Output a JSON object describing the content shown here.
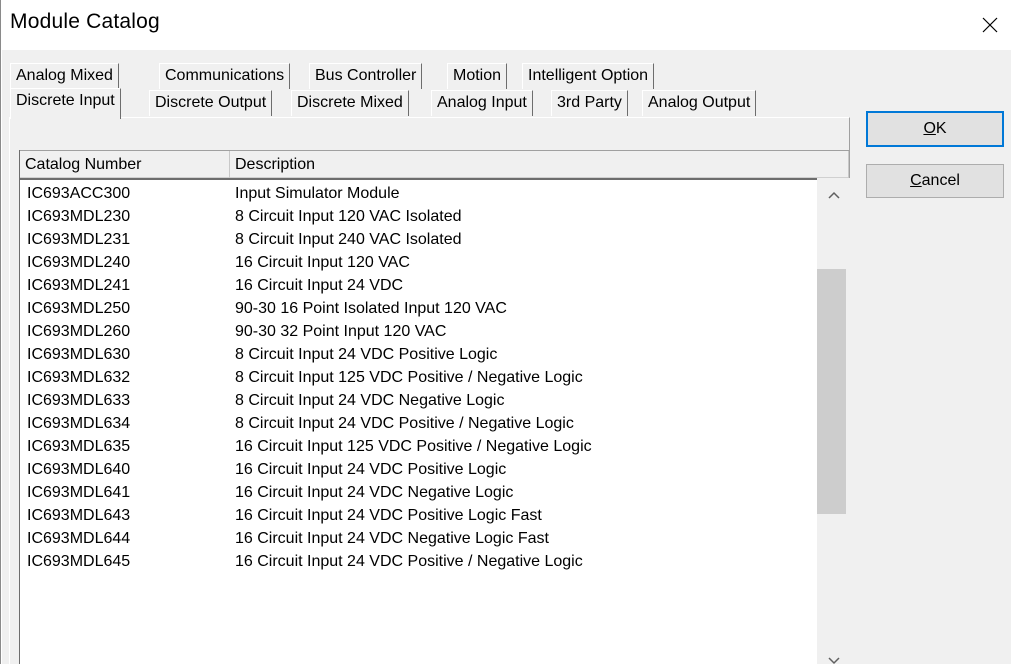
{
  "window": {
    "title": "Module Catalog"
  },
  "tabs_row1": [
    "Analog Mixed",
    "Communications",
    "Bus Controller",
    "Motion",
    "Intelligent Option"
  ],
  "tabs_row2": [
    "Discrete Input",
    "Discrete Output",
    "Discrete Mixed",
    "Analog Input",
    "3rd Party",
    "Analog Output"
  ],
  "active_tab": "Discrete Input",
  "list": {
    "columns": [
      "Catalog Number",
      "Description"
    ],
    "rows": [
      [
        "IC693ACC300",
        "Input Simulator Module"
      ],
      [
        "IC693MDL230",
        "8 Circuit Input 120 VAC Isolated"
      ],
      [
        "IC693MDL231",
        "8 Circuit Input 240 VAC Isolated"
      ],
      [
        "IC693MDL240",
        "16 Circuit Input 120 VAC"
      ],
      [
        "IC693MDL241",
        "16 Circuit Input 24 VDC"
      ],
      [
        "IC693MDL250",
        "90-30 16 Point Isolated Input 120 VAC"
      ],
      [
        "IC693MDL260",
        "90-30 32 Point Input 120 VAC"
      ],
      [
        "IC693MDL630",
        "8 Circuit Input 24 VDC Positive Logic"
      ],
      [
        "IC693MDL632",
        "8 Circuit Input 125 VDC Positive / Negative Logic"
      ],
      [
        "IC693MDL633",
        "8 Circuit Input 24 VDC Negative Logic"
      ],
      [
        "IC693MDL634",
        "8 Circuit Input 24 VDC Positive / Negative Logic"
      ],
      [
        "IC693MDL635",
        "16 Circuit Input 125 VDC Positive / Negative Logic"
      ],
      [
        "IC693MDL640",
        "16 Circuit Input 24 VDC Positive Logic"
      ],
      [
        "IC693MDL641",
        "16 Circuit Input 24 VDC Negative Logic"
      ],
      [
        "IC693MDL643",
        "16 Circuit Input 24 VDC Positive Logic Fast"
      ],
      [
        "IC693MDL644",
        "16 Circuit Input 24 VDC Negative Logic Fast"
      ],
      [
        "IC693MDL645",
        "16 Circuit Input 24 VDC Positive / Negative Logic"
      ]
    ],
    "scroll": {
      "thumb_start_fraction": 0.186,
      "thumb_size_fraction": 0.5
    }
  },
  "buttons": {
    "ok": {
      "mnemonic": "O",
      "rest": "K"
    },
    "cancel": {
      "mnemonic": "C",
      "rest": "ancel"
    }
  },
  "icons": {
    "close": "close-icon",
    "scroll_up": "chevron-up-icon",
    "scroll_down": "chevron-down-icon"
  },
  "colors": {
    "focus_border": "#0078d7",
    "dialog_face": "#f0f0f0",
    "scroll_thumb": "#cdcdcd"
  }
}
